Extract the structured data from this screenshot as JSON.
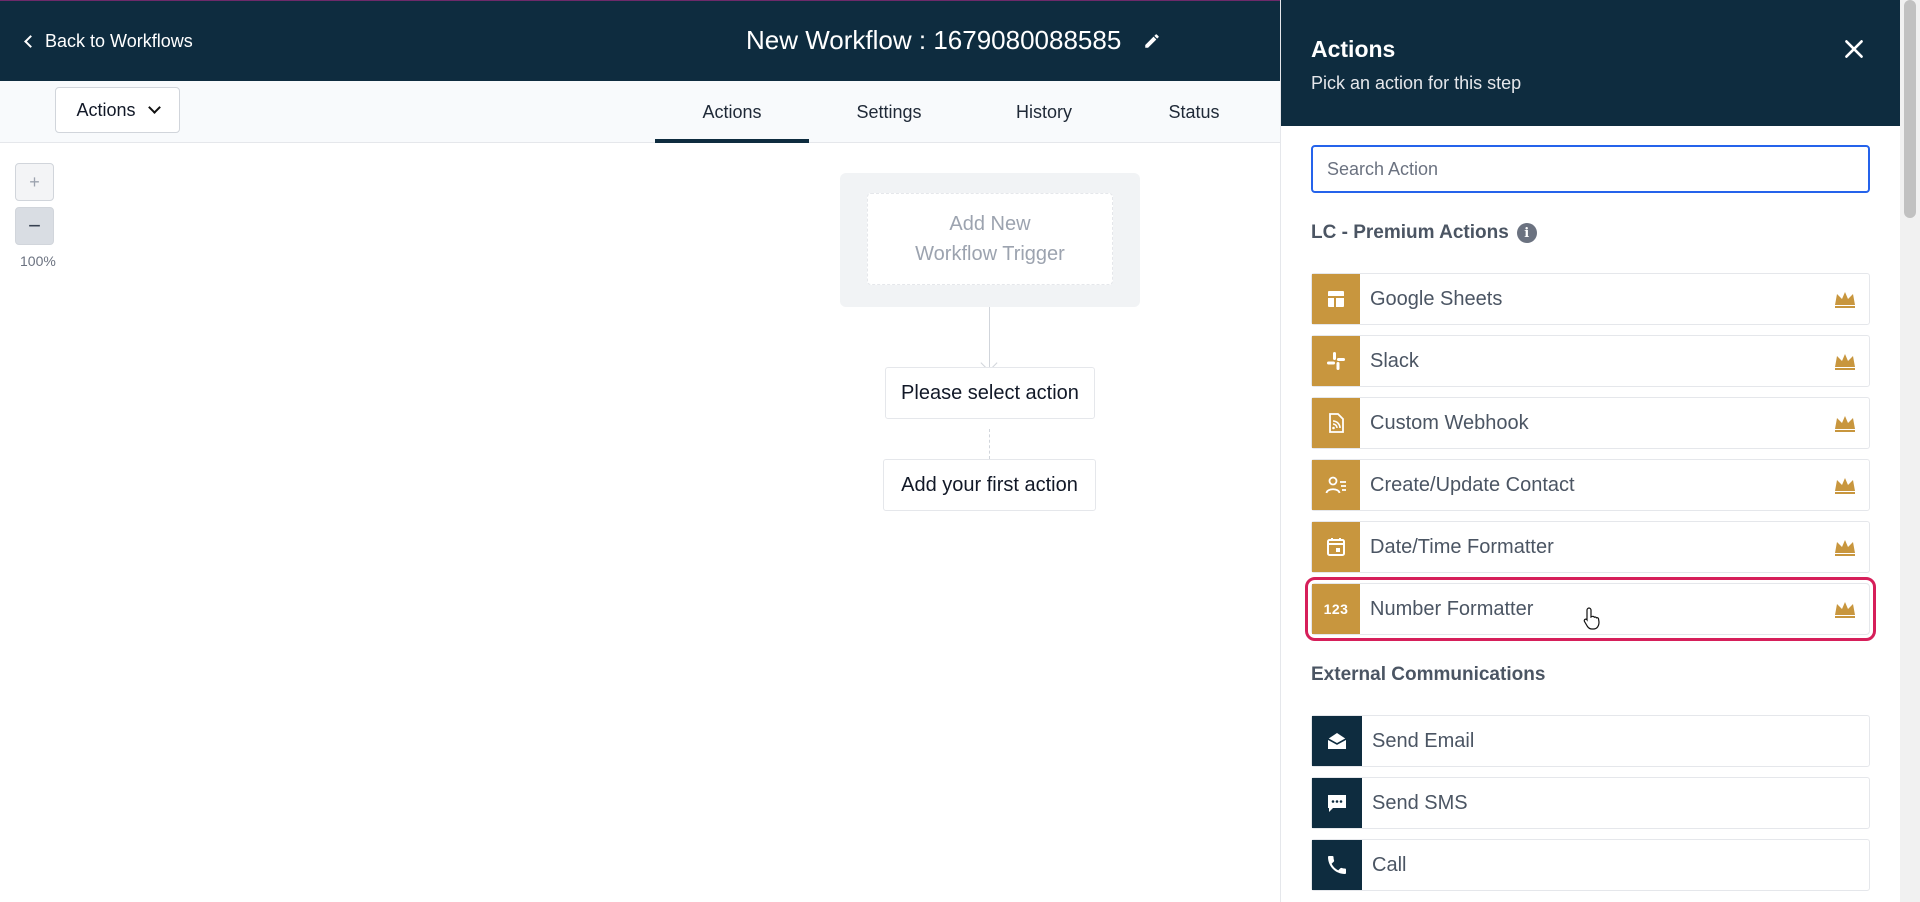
{
  "topbar": {
    "back_label": "Back to Workflows",
    "title": "New Workflow : 1679080088585"
  },
  "subbar": {
    "dropdown_label": "Actions",
    "tabs": [
      {
        "label": "Actions",
        "active": true
      },
      {
        "label": "Settings",
        "active": false
      },
      {
        "label": "History",
        "active": false
      },
      {
        "label": "Status",
        "active": false
      }
    ]
  },
  "canvas": {
    "zoom_in_label": "+",
    "zoom_out_label": "−",
    "zoom_level": "100%",
    "trigger_label_line1": "Add New",
    "trigger_label_line2": "Workflow Trigger",
    "select_action_label": "Please select action",
    "first_action_label": "Add your first action"
  },
  "panel": {
    "title": "Actions",
    "subtitle": "Pick an action for this step",
    "search_placeholder": "Search Action",
    "premium_section": "LC - Premium Actions",
    "premium_actions": [
      {
        "label": "Google Sheets",
        "icon": "table-icon"
      },
      {
        "label": "Slack",
        "icon": "slack-icon"
      },
      {
        "label": "Custom Webhook",
        "icon": "webhook-icon"
      },
      {
        "label": "Create/Update Contact",
        "icon": "contact-icon"
      },
      {
        "label": "Date/Time Formatter",
        "icon": "calendar-icon"
      },
      {
        "label": "Number Formatter",
        "icon": "number-icon",
        "highlighted": true
      }
    ],
    "external_section": "External Communications",
    "external_actions": [
      {
        "label": "Send Email",
        "icon": "mail-icon"
      },
      {
        "label": "Send SMS",
        "icon": "sms-icon"
      },
      {
        "label": "Call",
        "icon": "phone-icon"
      }
    ],
    "number_icon_text": "123"
  },
  "colors": {
    "header_bg": "#0e2c3f",
    "premium_gold": "#c8963e",
    "highlight": "#d61f5a",
    "search_border": "#2563eb"
  }
}
